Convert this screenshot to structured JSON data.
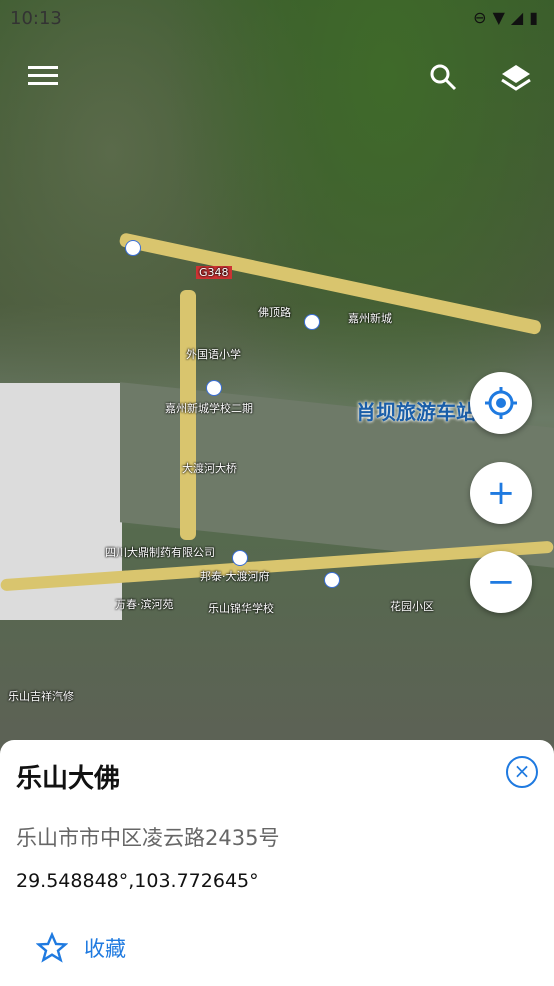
{
  "status_bar": {
    "time": "10:13"
  },
  "map": {
    "labels": [
      "佛顶路",
      "G348",
      "外国语小学",
      "嘉州新城学校二期",
      "大渡河大桥",
      "四川大鼎制药有限公司",
      "邦泰·大渡河府",
      "万春·滨河苑",
      "乐山锦华学校",
      "万春·滨河苑",
      "肖坝旅游车站",
      "嘉州新城",
      "花园小区",
      "乐山吉祥汽修"
    ],
    "big_label": "肖坝旅游车站"
  },
  "controls": {
    "menu_icon": "menu-icon",
    "search_icon": "search-icon",
    "layers_icon": "layers-icon",
    "locate_icon": "locate-icon",
    "zoom_in": "+",
    "zoom_out": "−"
  },
  "place": {
    "name": "乐山大佛",
    "address": "乐山市市中区凌云路2435号",
    "coordinates": "29.548848°,103.772645°",
    "favorite_label": "收藏"
  }
}
